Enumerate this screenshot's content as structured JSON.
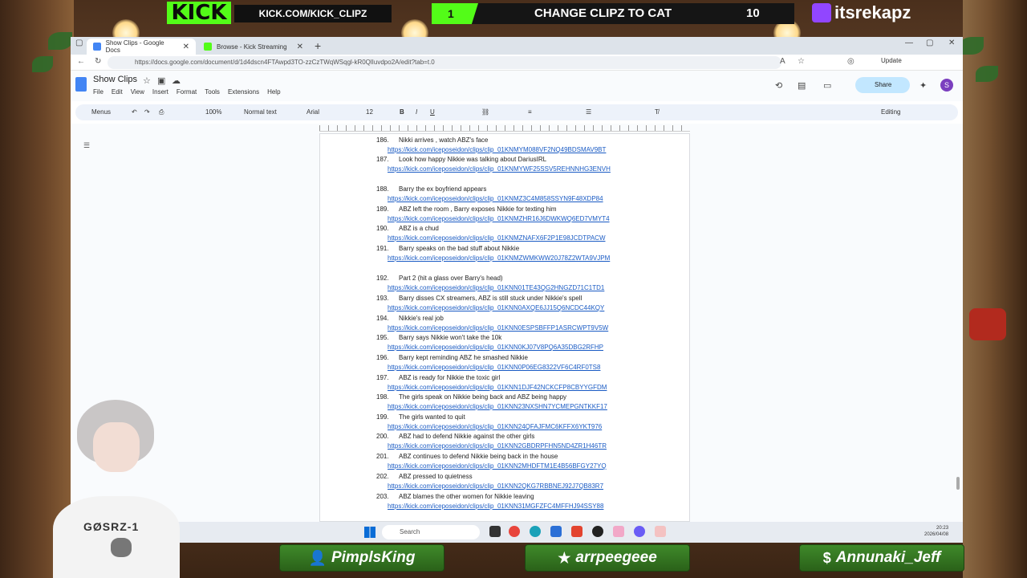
{
  "overlay": {
    "kick_logo": "KICK",
    "kick_url": "KICK.COM/KICK_CLIPZ",
    "goal_count": "1",
    "goal_title": "CHANGE CLIPZ TO CAT",
    "goal_target": "10",
    "twitch_handle": "itsrekapz",
    "vtuber_shirt": "GØSRZ-1"
  },
  "browser": {
    "tabs": [
      {
        "label": "Show Clips - Google Docs",
        "icon": "google-docs-icon"
      },
      {
        "label": "Browse - Kick Streaming",
        "icon": "kick-icon"
      }
    ],
    "url": "https://docs.google.com/document/d/1d4dscn4FTAwpd3TO-zzCzTWqWSqgl-kR0QlIuvdpo2A/edit?tab=t.0",
    "update_label": "Update"
  },
  "docs": {
    "title": "Show Clips",
    "menus": [
      "File",
      "Edit",
      "View",
      "Insert",
      "Format",
      "Tools",
      "Extensions",
      "Help"
    ],
    "share_label": "Share",
    "avatar_letter": "S",
    "toolbar": {
      "menus_label": "Menus",
      "zoom": "100%",
      "style": "Normal text",
      "font": "Arial",
      "font_size": "12",
      "mode": "Editing"
    }
  },
  "entries": [
    {
      "num": "186.",
      "title": "Nikki arrives , watch ABZ's face",
      "link": "https://kick.com/iceposeidon/clips/clip_01KNMYM088VF2NQ49BDSMAV9BT"
    },
    {
      "num": "187.",
      "title": "Look how happy Nikkie was talking about DariusIRL",
      "link": "https://kick.com/iceposeidon/clips/clip_01KNMYWF25SSV5REHNNHG3ENVH"
    },
    {
      "num": "188.",
      "title": "Barry the ex boyfriend appears",
      "link": "https://kick.com/iceposeidon/clips/clip_01KNMZ3C4M858SSYN9F48XDP84"
    },
    {
      "num": "189.",
      "title": "ABZ left the room , Barry exposes Nikkie for texting him",
      "link": "https://kick.com/iceposeidon/clips/clip_01KNMZHR16J6DWKWQ6ED7VMYT4"
    },
    {
      "num": "190.",
      "title": "ABZ is a chud",
      "link": "https://kick.com/iceposeidon/clips/clip_01KNMZNAFX6F2P1E98JCDTPACW"
    },
    {
      "num": "191.",
      "title": "Barry speaks on the bad stuff about Nikkie",
      "link": "https://kick.com/iceposeidon/clips/clip_01KNMZWMKWW20J78Z2WTA9VJPM"
    },
    {
      "num": "192.",
      "title": "Part 2 (hit a glass over Barry's head)",
      "link": "https://kick.com/iceposeidon/clips/clip_01KNN01TE43QG2HNGZD71C1TD1"
    },
    {
      "num": "193.",
      "title": "Barry disses CX streamers, ABZ is still stuck under Nikkie's spell",
      "link": "https://kick.com/iceposeidon/clips/clip_01KNN0AXQE6JJ15Q6NCDC44KQY"
    },
    {
      "num": "194.",
      "title": "Nikkie's real job",
      "link": "https://kick.com/iceposeidon/clips/clip_01KNN0ESPSBFFP1ASRCWPT9V5W"
    },
    {
      "num": "195.",
      "title": "Barry says Nikkie won't take the 10k",
      "link": "https://kick.com/iceposeidon/clips/clip_01KNN0KJ07V8PQ6A35DBG2RFHP"
    },
    {
      "num": "196.",
      "title": "Barry kept reminding ABZ he smashed Nikkie",
      "link": "https://kick.com/iceposeidon/clips/clip_01KNN0P06EG8322VF6C4RF0TS8"
    },
    {
      "num": "197.",
      "title": "ABZ is ready for Nikkie the toxic girl",
      "link": "https://kick.com/iceposeidon/clips/clip_01KNN1DJF42NCKCFP8CBYYGFDM"
    },
    {
      "num": "198.",
      "title": "The girls speak on Nikkie being back and ABZ being happy",
      "link": "https://kick.com/iceposeidon/clips/clip_01KNN23NXSHN7YCMEPGNTKKF17"
    },
    {
      "num": "199.",
      "title": "The girls wanted to quit",
      "link": "https://kick.com/iceposeidon/clips/clip_01KNN24QFAJFMC6KFFX6YKT976"
    },
    {
      "num": "200.",
      "title": "ABZ had to defend Nikkie against the other girls",
      "link": "https://kick.com/iceposeidon/clips/clip_01KNN2GBDRPFHN5ND4ZR1H46TR"
    },
    {
      "num": "201.",
      "title": "ABZ continues to defend Nikkie being back in the house",
      "link": "https://kick.com/iceposeidon/clips/clip_01KNN2MHDFTM1E4B56BFGY27YQ"
    },
    {
      "num": "202.",
      "title": "ABZ pressed to quietness",
      "link": "https://kick.com/iceposeidon/clips/clip_01KNN2QKG7RBBNEJ92J7QB83R7"
    },
    {
      "num": "203.",
      "title": "ABZ blames the other women for Nikkie leaving",
      "link": "https://kick.com/iceposeidon/clips/clip_01KNN31MGFZFC4MFFHJ94SSY88"
    }
  ],
  "taskbar": {
    "search_label": "Search",
    "time": "20:23",
    "date": "2026/04/08"
  },
  "bottom_labels": [
    {
      "name": "PimplsKing",
      "icon": "person-icon"
    },
    {
      "name": "arrpeegeee",
      "icon": "star-icon"
    },
    {
      "name": "Annunaki_Jeff",
      "icon": "dollar-icon"
    }
  ]
}
